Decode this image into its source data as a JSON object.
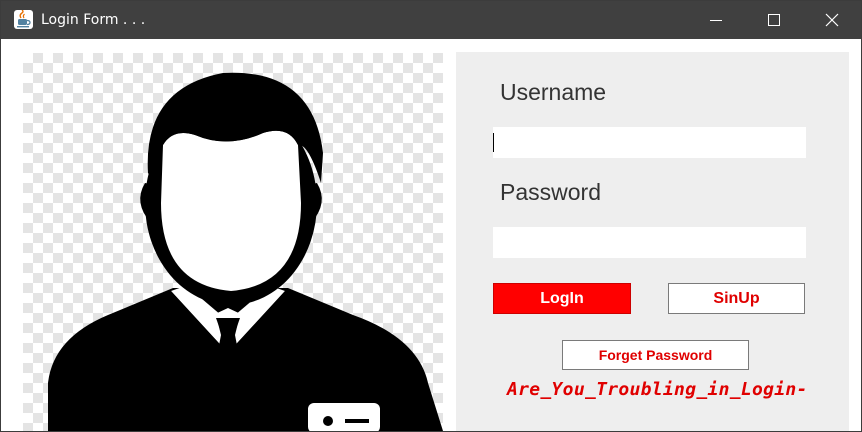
{
  "window": {
    "title": "Login Form . . .",
    "icon": "java-cup-icon",
    "controls": [
      "minimize-icon",
      "maximize-icon",
      "close-icon"
    ]
  },
  "photo": {
    "icon": "user-avatar-icon"
  },
  "form": {
    "username_label": "Username",
    "username_value": "",
    "password_label": "Password",
    "password_value": "",
    "login_label": "LogIn",
    "signup_label": "SinUp",
    "forget_label": "Forget Password",
    "help_text": "Are_You_Troubling_in_Login-"
  },
  "colors": {
    "titlebar": "#404040",
    "panel": "#eeeeee",
    "accent_red": "#ff0000",
    "text_red": "#e00000"
  }
}
